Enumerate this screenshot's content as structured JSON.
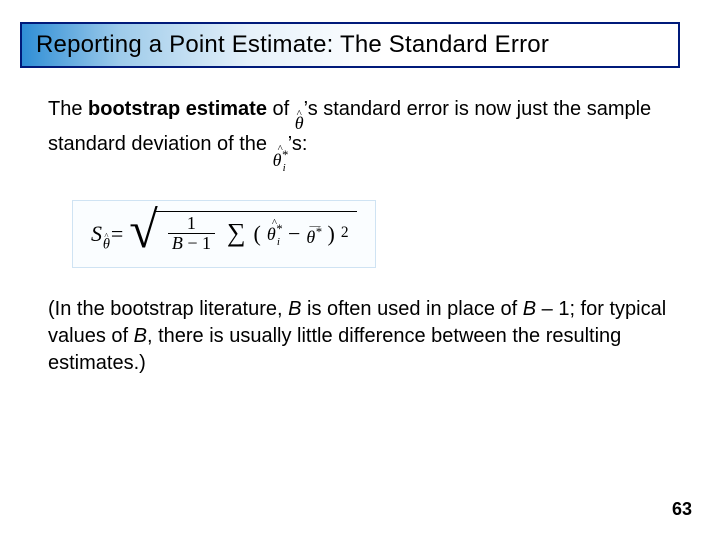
{
  "title": "Reporting a Point Estimate: The Standard Error",
  "intro": {
    "part1": "The ",
    "bold": "bootstrap estimate",
    "part2": " of ",
    "part3": "’s standard error is now just the sample standard deviation of the ",
    "part4": "’s:"
  },
  "symbols": {
    "theta_hat_hat": "^",
    "theta_hat_theta": "θ",
    "theta_hat_i_hat": "^",
    "theta_hat_i_theta": "θ",
    "theta_hat_i_star": "*",
    "theta_hat_i_sub": "i"
  },
  "formula": {
    "lhs_S": "S",
    "lhs_sub_hat": "^",
    "lhs_sub_theta": "θ",
    "eq": " = ",
    "frac_num": "1",
    "frac_den_B": "B",
    "frac_den_minus": " − 1",
    "sigma": "∑",
    "paren_open": "(",
    "term_hat": "^",
    "term_theta": "θ",
    "term_star": "*",
    "term_sub": "i",
    "minus": " − ",
    "bar": "―",
    "bar_theta": "θ",
    "bar_star": "*",
    "paren_close": ")",
    "sq": "2"
  },
  "note": {
    "part1": "(In the bootstrap literature, ",
    "B1": "B",
    "part2": " is often used in place of ",
    "B2": "B",
    "part3": " – 1; for typical values of ",
    "B3": "B",
    "part4": ", there is usually little difference between the resulting estimates.)"
  },
  "page": "63"
}
